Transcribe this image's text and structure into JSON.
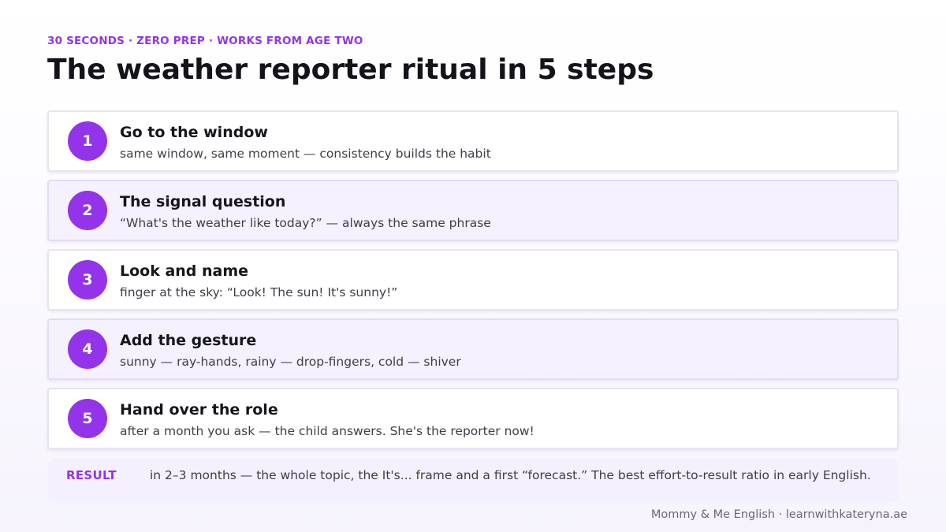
{
  "header": {
    "eyebrow": "30 SECONDS · ZERO PREP · WORKS FROM AGE TWO",
    "title": "The weather reporter ritual in 5 steps"
  },
  "steps": [
    {
      "number": "1",
      "title": "Go to the window",
      "description": "same window, same moment — consistency builds the habit"
    },
    {
      "number": "2",
      "title": "The signal question",
      "description": "“What's the weather like today?” — always the same phrase"
    },
    {
      "number": "3",
      "title": "Look and name",
      "description": "finger at the sky: “Look! The sun! It's sunny!”"
    },
    {
      "number": "4",
      "title": "Add the gesture",
      "description": "sunny — ray-hands, rainy — drop-fingers, cold — shiver"
    },
    {
      "number": "5",
      "title": "Hand over the role",
      "description": "after a month you ask — the child answers. She's the reporter now!"
    }
  ],
  "result": {
    "label": "RESULT",
    "text": "in 2–3 months — the whole topic, the It's... frame and a first “forecast.” The best effort-to-result ratio in early English."
  },
  "footer": {
    "text": "Mommy & Me English · learnwithkateryna.ae"
  },
  "colors": {
    "accent": "#9333ea",
    "alt_row": "#f5f1fe"
  }
}
